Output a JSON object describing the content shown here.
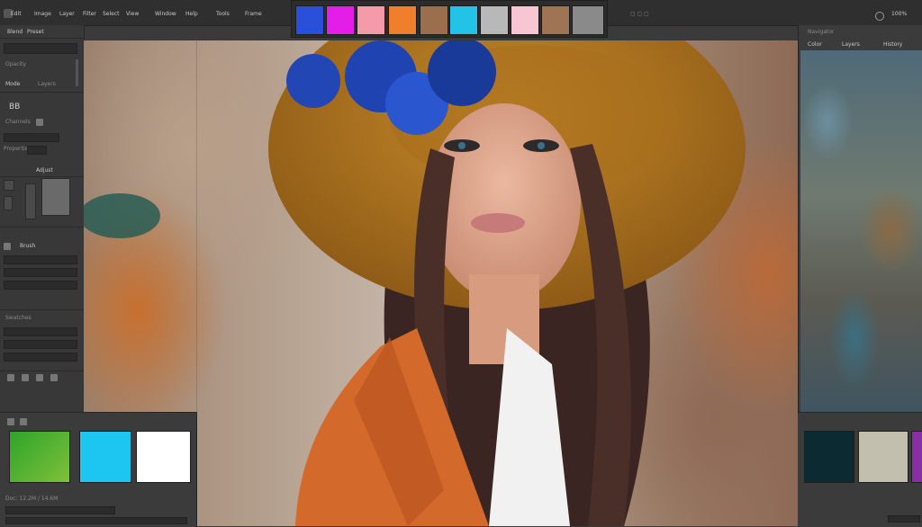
{
  "menubar": {
    "items": [
      "Edit",
      "Image",
      "Layer",
      "Filter",
      "Select",
      "View",
      "Window",
      "Help",
      "Tools",
      "Frame"
    ],
    "right_label": "100%"
  },
  "left_panel": {
    "labels": [
      "Blend",
      "Preset",
      "Opacity",
      "Mode",
      "Layers",
      "Channels",
      "Properties",
      "Adjust",
      "Brush",
      "Swatches"
    ]
  },
  "top_swatches": {
    "colors": [
      "#2a4fd8",
      "#e41ee9",
      "#f59aa8",
      "#ef7f2b",
      "#9b6e4e",
      "#22c3e6",
      "#b8b8b8",
      "#f8c6d2",
      "#9e7455",
      "#8a8a8a"
    ]
  },
  "right_panel": {
    "tabs": [
      "Color",
      "Layers",
      "History"
    ],
    "top_label": "Navigator"
  },
  "bottom_left": {
    "swatch_colors": [
      "#3fae2a",
      "#1cc6f0",
      "#ffffff"
    ],
    "status_text": "Doc: 12.2M / 14.6M"
  },
  "bottom_right": {
    "swatch_colors": [
      "#0c2a32",
      "#c2bfae",
      "#8a2ea6"
    ]
  },
  "canvas": {
    "hat_color": "#b9791f",
    "flower_color": "#1f43b0",
    "coat_color": "#d4692c",
    "hair_color": "#3a2522",
    "skin_color": "#e1a88e"
  }
}
